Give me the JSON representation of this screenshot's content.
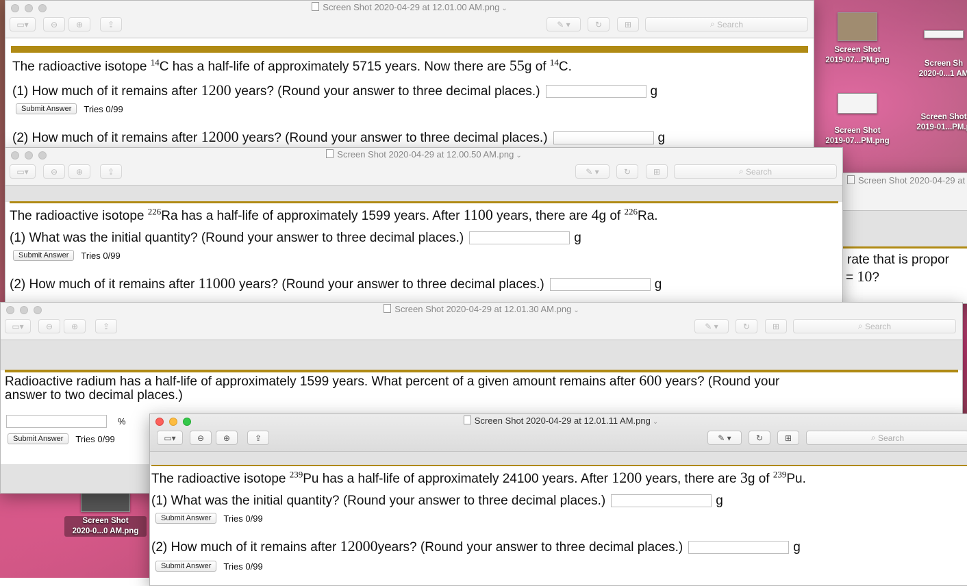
{
  "desktop": {
    "icons": [
      {
        "label1": "Screen Shot",
        "label2": "2019-07...PM.png"
      },
      {
        "label1": "Screen Sh",
        "label2": "2020-0...1 AM"
      },
      {
        "label1": "Screen Shot",
        "label2": "2019-07...PM.png"
      },
      {
        "label1": "Screen Shot",
        "label2": "2019-01...PM.p"
      },
      {
        "label1": "Screen Shot",
        "label2": "2020-0...0 AM.png"
      }
    ]
  },
  "toolbar": {
    "search_placeholder": "Search",
    "chevron": "⌄"
  },
  "win1": {
    "title": "Screen Shot 2020-04-29 at 12.01.00 AM.png",
    "q_a": "The radioactive isotope ",
    "sup1": "14",
    "q_b": "C has a half-life of approximately 5715 years. Now there are ",
    "q_num": "55",
    "q_c": "g of ",
    "sup2": "14",
    "q_d": "C.",
    "p1_a": "(1) How much of it remains after ",
    "p1_num": "1200",
    "p1_b": " years? (Round your answer to three decimal places.)",
    "unit": "g",
    "submit": "Submit Answer",
    "tries": "Tries 0/99",
    "p2_a": "(2) How much of it remains after ",
    "p2_num": "12000",
    "p2_b": " years? (Round your answer to three decimal places.)"
  },
  "win2": {
    "title": "Screen Shot 2020-04-29 at 12.00.50 AM.png",
    "q_a": "The radioactive isotope ",
    "sup1": "226",
    "q_b": "Ra has a half-life of approximately 1599 years. After ",
    "q_num": "1100",
    "q_c": " years, there are ",
    "q_num2": "4",
    "q_d": "g of ",
    "sup2": "226",
    "q_e": "Ra.",
    "p1": "(1) What was the initial quantity? (Round your answer to three decimal places.)",
    "unit": "g",
    "submit": "Submit Answer",
    "tries": "Tries 0/99",
    "p2_a": "(2) How much of it remains after ",
    "p2_num": "11000",
    "p2_b": " years? (Round your answer to three decimal places.)"
  },
  "win_back": {
    "title": "Screen Shot 2020-04-29 at 1",
    "line1": "rate that is propor",
    "line2_a": "= ",
    "line2_num": "10",
    "line2_b": "?"
  },
  "win3": {
    "title": "Screen Shot 2020-04-29 at 12.01.30 AM.png",
    "q_a": "Radioactive radium has a half-life of approximately 1599 years. What percent of a given amount remains after ",
    "q_num": "600",
    "q_b": " years? (Round your",
    "q_line2": "answer to two decimal places.)",
    "unit": "%",
    "submit": "Submit Answer",
    "tries": "Tries 0/99"
  },
  "win4": {
    "title": "Screen Shot 2020-04-29 at 12.01.11 AM.png",
    "q_a": "The radioactive isotope ",
    "sup1": "239",
    "q_b": "Pu has a half-life of approximately 24100 years. After ",
    "q_num": "1200",
    "q_c": " years, there are ",
    "q_num2": "3",
    "q_d": "g of ",
    "sup2": "239",
    "q_e": "Pu.",
    "p1": "(1) What was the initial quantity? (Round your answer to three decimal places.)",
    "unit": "g",
    "submit": "Submit Answer",
    "tries": "Tries 0/99",
    "p2_a": "(2) How much of it remains after ",
    "p2_num": "12000",
    "p2_b": "years? (Round your answer to three decimal places.)"
  }
}
